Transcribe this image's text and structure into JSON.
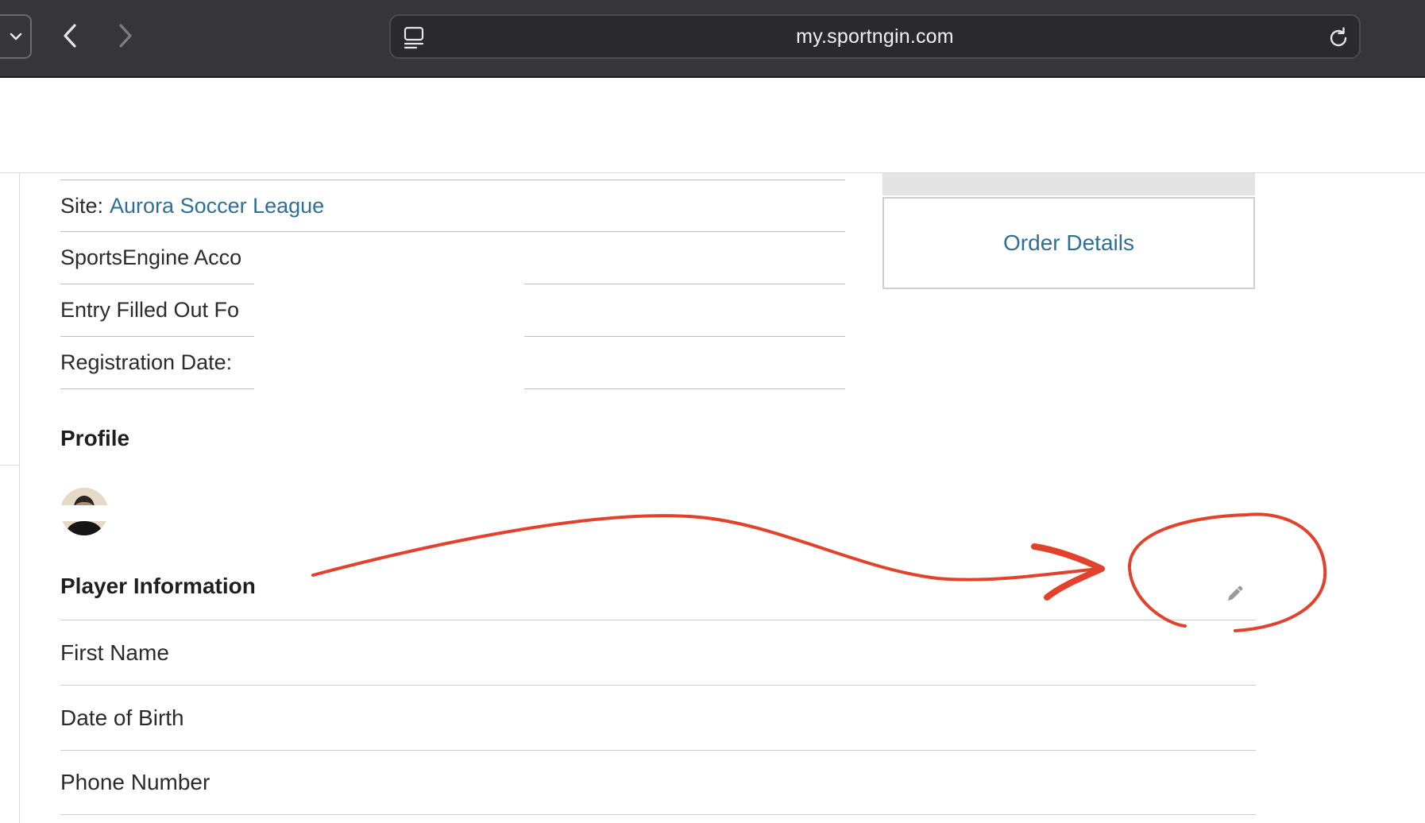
{
  "browser": {
    "url": "my.sportngin.com",
    "icons": {
      "tab_menu": "chevron-down-icon",
      "back": "chevron-left-icon",
      "forward": "chevron-right-icon",
      "reader": "reader-view-icon",
      "reload": "reload-icon"
    }
  },
  "summary": {
    "site_label": "Site:",
    "site_link": "Aurora Soccer League",
    "account_label": "SportsEngine Acco",
    "entry_label": "Entry Filled Out Fo",
    "registration_label": "Registration Date:"
  },
  "side_card": {
    "order_details_label": "Order Details"
  },
  "profile": {
    "title": "Profile"
  },
  "player_info": {
    "title": "Player Information",
    "rows": [
      {
        "label": "First Name"
      },
      {
        "label": "Date of Birth"
      },
      {
        "label": "Phone Number"
      }
    ],
    "edit_icon": "pencil-icon"
  },
  "colors": {
    "toolbar_bg": "#36363a",
    "link": "#2f6f96",
    "annotation": "#e2412b"
  }
}
